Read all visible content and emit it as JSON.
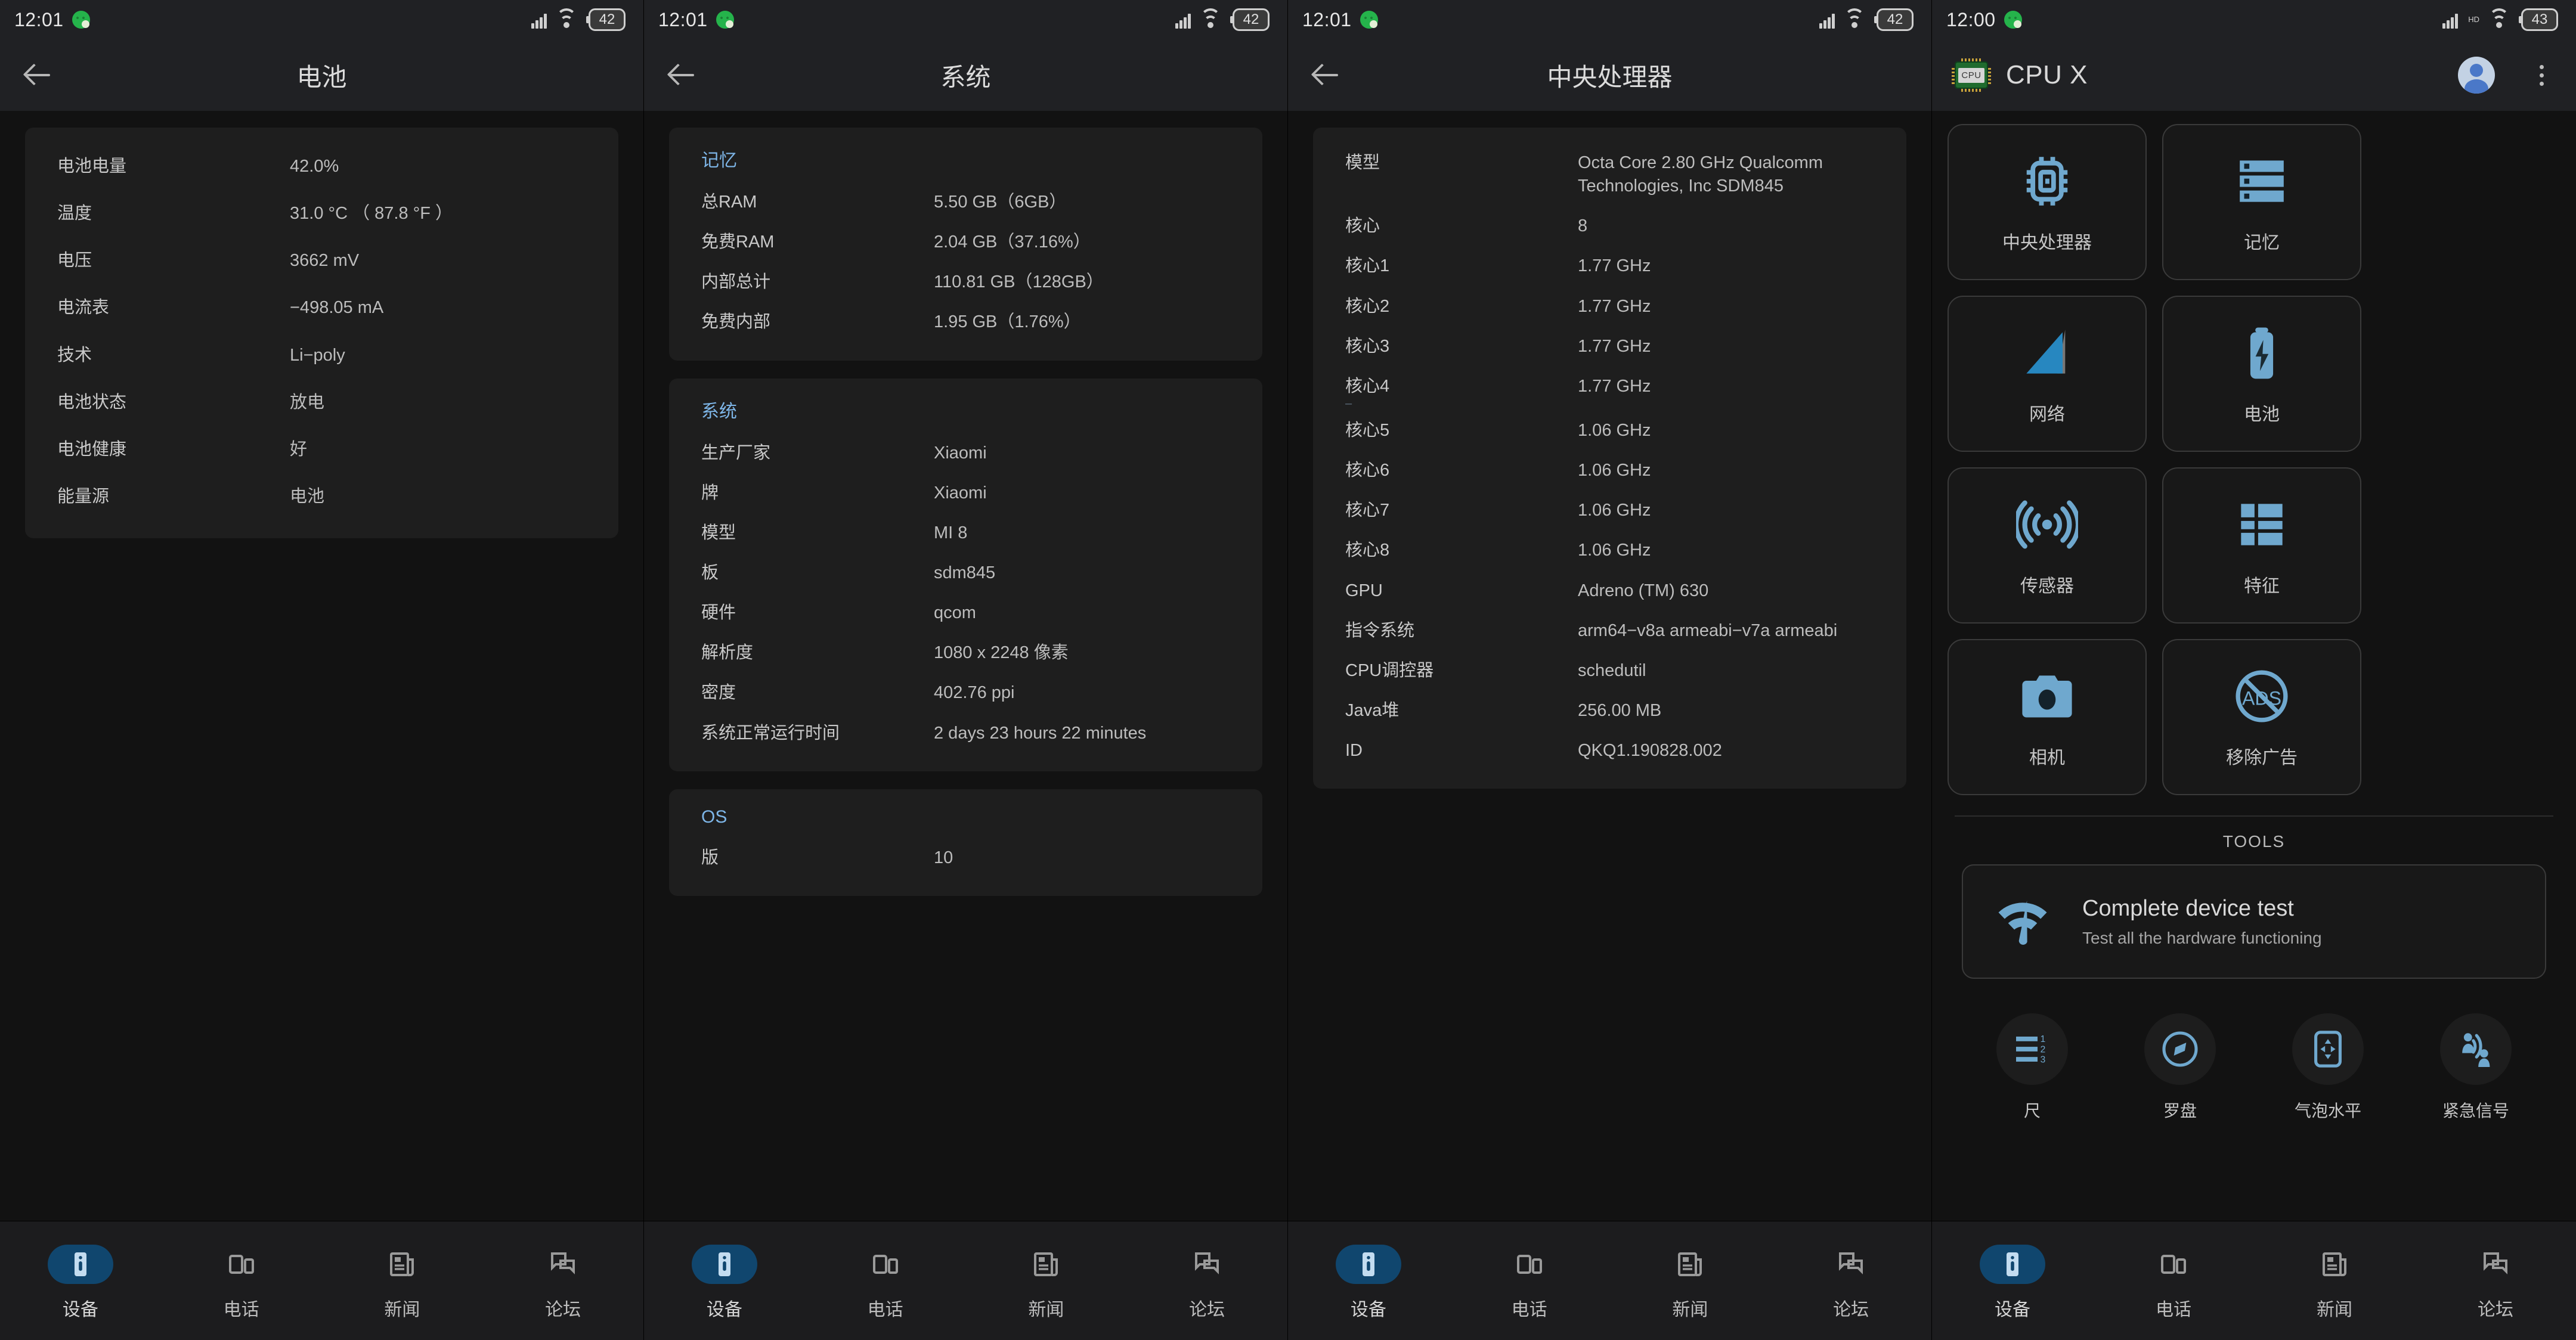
{
  "screens": [
    {
      "status": {
        "time": "12:01",
        "battery": "42",
        "network": "4G",
        "wifi": "wifi-icon",
        "app_dot": "whatsapp-dot-icon"
      },
      "appbar": {
        "title": "电池",
        "back": "back-arrow-icon"
      },
      "sections": [
        {
          "title": "",
          "rows": [
            {
              "k": "电池电量",
              "v": "42.0%"
            },
            {
              "k": "温度",
              "v": "31.0 °C  （ 87.8 °F ）"
            },
            {
              "k": "电压",
              "v": "3662 mV"
            },
            {
              "k": "电流表",
              "v": "−498.05 mA"
            },
            {
              "k": "技术",
              "v": "Li−poly"
            },
            {
              "k": "电池状态",
              "v": "放电"
            },
            {
              "k": "电池健康",
              "v": "好"
            },
            {
              "k": "能量源",
              "v": "电池"
            }
          ]
        }
      ]
    },
    {
      "status": {
        "time": "12:01",
        "battery": "42",
        "network": "4G",
        "wifi": "wifi-icon",
        "app_dot": "whatsapp-dot-icon"
      },
      "appbar": {
        "title": "系统",
        "back": "back-arrow-icon"
      },
      "sections": [
        {
          "title": "记忆",
          "rows": [
            {
              "k": "总RAM",
              "v": "5.50 GB（6GB）"
            },
            {
              "k": "免费RAM",
              "v": "2.04 GB（37.16%）"
            },
            {
              "k": "内部总计",
              "v": "110.81 GB（128GB）"
            },
            {
              "k": "免费内部",
              "v": "1.95 GB（1.76%）"
            }
          ]
        },
        {
          "title": "系统",
          "rows": [
            {
              "k": "生产厂家",
              "v": "Xiaomi"
            },
            {
              "k": "牌",
              "v": "Xiaomi"
            },
            {
              "k": "模型",
              "v": "MI 8"
            },
            {
              "k": "板",
              "v": "sdm845"
            },
            {
              "k": "硬件",
              "v": "qcom"
            },
            {
              "k": "解析度",
              "v": "1080 x 2248 像素"
            },
            {
              "k": "密度",
              "v": "402.76 ppi"
            },
            {
              "k": "系统正常运行时间",
              "v": "2 days 23 hours 22 minutes"
            }
          ]
        },
        {
          "title": "OS",
          "rows": [
            {
              "k": "版",
              "v": "10"
            }
          ]
        }
      ]
    },
    {
      "status": {
        "time": "12:01",
        "battery": "42",
        "network": "4G",
        "wifi": "wifi-icon",
        "app_dot": "whatsapp-dot-icon"
      },
      "appbar": {
        "title": "中央处理器",
        "back": "back-arrow-icon"
      },
      "sections": [
        {
          "title": "",
          "rows": [
            {
              "k": "模型",
              "v": "Octa Core 2.80 GHz Qualcomm Technologies, Inc SDM845"
            },
            {
              "k": "核心",
              "v": "8"
            },
            {
              "k": "核心1",
              "v": "1.77 GHz"
            },
            {
              "k": "核心2",
              "v": "1.77 GHz"
            },
            {
              "k": "核心3",
              "v": "1.77 GHz"
            },
            {
              "k": "核心4",
              "v": "1.77 GHz"
            },
            {
              "k": "核心5",
              "v": "1.06 GHz"
            },
            {
              "k": "核心6",
              "v": "1.06 GHz"
            },
            {
              "k": "核心7",
              "v": "1.06 GHz"
            },
            {
              "k": "核心8",
              "v": "1.06 GHz"
            },
            {
              "k": "GPU",
              "v": "Adreno (TM) 630"
            },
            {
              "k": "指令系统",
              "v": "arm64−v8a armeabi−v7a armeabi"
            },
            {
              "k": "CPU调控器",
              "v": "schedutil"
            },
            {
              "k": "Java堆",
              "v": "256.00 MB"
            },
            {
              "k": "ID",
              "v": "QKQ1.190828.002"
            }
          ]
        }
      ]
    },
    {
      "status": {
        "time": "12:00",
        "battery": "43",
        "network": "HD",
        "wifi": "wifi-icon",
        "app_dot": "whatsapp-dot-icon"
      },
      "appbar": {
        "app_name": "CPU X",
        "logo": "cpu-chip-logo",
        "logo_text": "CPU",
        "avatar": "account-avatar",
        "menu": "overflow-menu-icon"
      },
      "tiles": [
        {
          "label": "中央处理器",
          "icon": "cpu-chip-icon"
        },
        {
          "label": "记忆",
          "icon": "memory-stack-icon"
        },
        {
          "label": "网络",
          "icon": "network-signal-icon"
        },
        {
          "label": "电池",
          "icon": "battery-bolt-icon"
        },
        {
          "label": "传感器",
          "icon": "sensor-waves-icon"
        },
        {
          "label": "特征",
          "icon": "features-grid-icon"
        },
        {
          "label": "相机",
          "icon": "camera-icon"
        },
        {
          "label": "移除广告",
          "icon": "no-ads-icon"
        }
      ],
      "tools_header": "TOOLS",
      "test_card": {
        "title": "Complete device test",
        "subtitle": "Test all the hardware functioning",
        "icon": "device-test-icon"
      },
      "tools": [
        {
          "label": "尺",
          "icon": "ruler-icon"
        },
        {
          "label": "罗盘",
          "icon": "compass-icon"
        },
        {
          "label": "气泡水平",
          "icon": "bubble-level-icon"
        },
        {
          "label": "紧急信号",
          "icon": "emergency-signal-icon"
        }
      ]
    }
  ],
  "bottom_nav": {
    "items": [
      {
        "label": "设备",
        "icon": "device-info-icon",
        "active": true
      },
      {
        "label": "电话",
        "icon": "phone-compare-icon",
        "active": false
      },
      {
        "label": "新闻",
        "icon": "news-icon",
        "active": false
      },
      {
        "label": "论坛",
        "icon": "forum-icon",
        "active": false
      }
    ]
  },
  "colors": {
    "accent": "#7eb6e8",
    "tile_icon": "#6fa8ce",
    "active_pill": "#10466e",
    "card_bg": "#1e1e1e",
    "page_bg": "#121212"
  }
}
